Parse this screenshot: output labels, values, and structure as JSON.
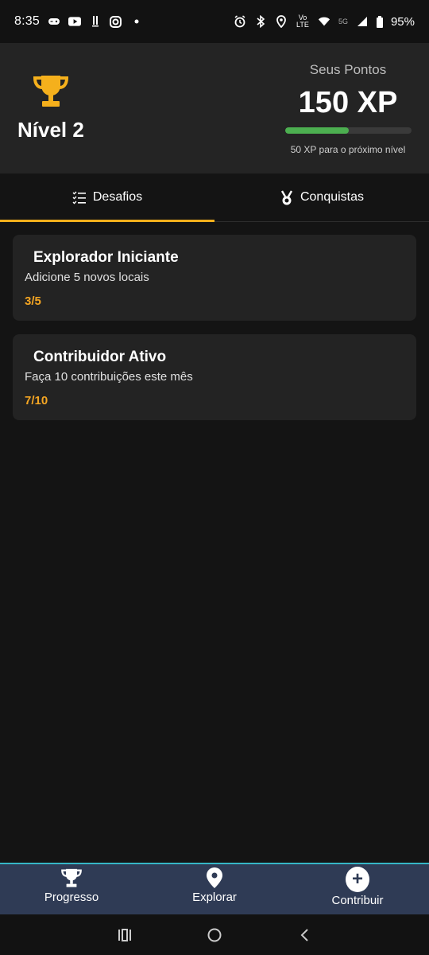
{
  "status_bar": {
    "time": "8:35",
    "battery": "95%",
    "network": "5G",
    "volte": "Vo LTE"
  },
  "header": {
    "level_label": "Nível 2",
    "points_title": "Seus Pontos",
    "points_value": "150 XP",
    "xp_progress": 0.5,
    "next_level_text": "50 XP para o próximo nível",
    "trophy_color": "#f5b01c",
    "progress_color": "#4caf50"
  },
  "tabs": [
    {
      "label": "Desafios",
      "icon": "checklist-icon",
      "active": true
    },
    {
      "label": "Conquistas",
      "icon": "medal-icon",
      "active": false
    }
  ],
  "challenges": [
    {
      "title": "Explorador Iniciante",
      "description": "Adicione 5 novos locais",
      "progress": "3/5"
    },
    {
      "title": "Contribuidor Ativo",
      "description": "Faça 10 contribuições este mês",
      "progress": "7/10"
    }
  ],
  "bottom_nav": [
    {
      "label": "Progresso",
      "icon": "trophy-icon"
    },
    {
      "label": "Explorar",
      "icon": "map-pin-icon"
    },
    {
      "label": "Contribuir",
      "icon": "plus-circle-icon"
    }
  ],
  "colors": {
    "accent": "#f5b01c",
    "progress_text": "#f5a623",
    "nav_bg": "#2f3b55",
    "nav_border": "#36b6c6"
  }
}
